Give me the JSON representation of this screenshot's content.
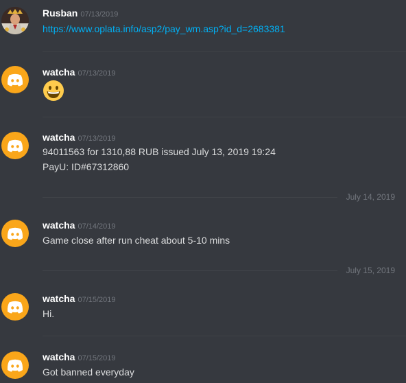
{
  "messages": [
    {
      "author": "Rusban",
      "timestamp": "07/13/2019",
      "lines": [
        "https://www.oplata.info/asp2/pay_wm.asp?id_d=2683381"
      ]
    },
    {
      "author": "watcha",
      "timestamp": "07/13/2019",
      "emoji": "grinning-face"
    },
    {
      "author": "watcha",
      "timestamp": "07/13/2019",
      "lines": [
        "94011563 for 1310,88 RUB issued July 13, 2019 19:24",
        "PayU:  ID#67312860"
      ]
    },
    {
      "author": "watcha",
      "timestamp": "07/14/2019",
      "lines": [
        "Game close after run cheat about 5-10 mins"
      ]
    },
    {
      "author": "watcha",
      "timestamp": "07/15/2019",
      "lines": [
        "Hi."
      ]
    },
    {
      "author": "watcha",
      "timestamp": "07/15/2019",
      "lines": [
        "Got banned everyday"
      ]
    }
  ],
  "dividers": [
    "July 14, 2019",
    "July 15, 2019"
  ],
  "colors": {
    "background": "#36393f",
    "username": "#ffffff",
    "timestamp": "#72767d",
    "text": "#dcddde",
    "link": "#00b0f4",
    "discord_avatar": "#faa61a"
  }
}
